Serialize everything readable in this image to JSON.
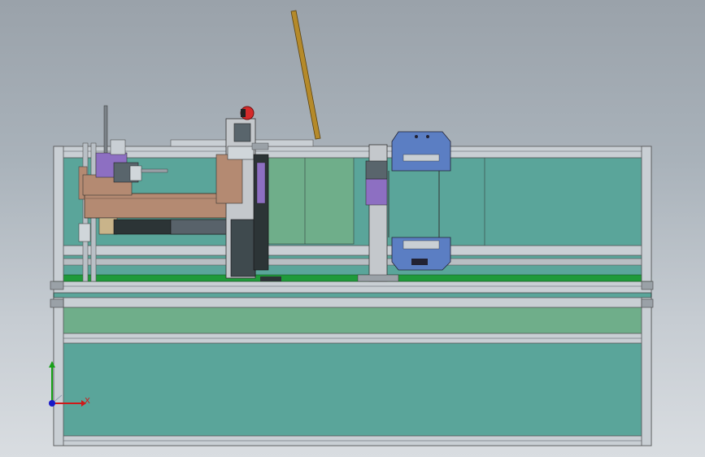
{
  "viewport": {
    "background_top": "#9aa2aa",
    "background_bottom": "#d9dde1"
  },
  "colors": {
    "panel": "#5aa59a",
    "panel_light": "#6fae8a",
    "rail": "#c9cfd4",
    "rail_dark": "#6e767d",
    "green_strip": "#1f9a3a",
    "carriage": "#b48a72",
    "column": "#c4c8cc",
    "bracket": "#5b7ec3",
    "purple": "#8d6fc2",
    "rod": "#b58a2a",
    "stop_button": "#d42a2a"
  },
  "triad": {
    "x_label": "X",
    "x_color": "#d01818",
    "y_color": "#18a018",
    "z_color": "#1818c8"
  }
}
